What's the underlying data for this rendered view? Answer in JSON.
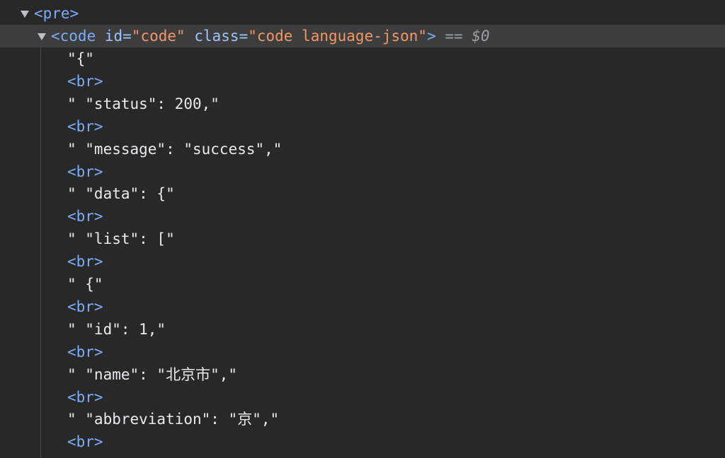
{
  "tree": {
    "pre_tag": "<pre>",
    "code_line": {
      "open": "<code",
      "id_attr": "id",
      "id_value": "\"code\"",
      "class_attr": "class",
      "class_value": "\"code language-json\"",
      "close": ">",
      "selected_marker": "==",
      "selected_var": "$0"
    },
    "children": [
      {
        "kind": "text",
        "value": "\"{\""
      },
      {
        "kind": "br",
        "value": "<br>"
      },
      {
        "kind": "text",
        "value": "\" \"status\": 200,\""
      },
      {
        "kind": "br",
        "value": "<br>"
      },
      {
        "kind": "text",
        "value": "\" \"message\": \"success\",\""
      },
      {
        "kind": "br",
        "value": "<br>"
      },
      {
        "kind": "text",
        "value": "\" \"data\": {\""
      },
      {
        "kind": "br",
        "value": "<br>"
      },
      {
        "kind": "text",
        "value": "\" \"list\": [\""
      },
      {
        "kind": "br",
        "value": "<br>"
      },
      {
        "kind": "text",
        "value": "\" {\""
      },
      {
        "kind": "br",
        "value": "<br>"
      },
      {
        "kind": "text",
        "value": "\" \"id\": 1,\""
      },
      {
        "kind": "br",
        "value": "<br>"
      },
      {
        "kind": "text",
        "value": "\" \"name\": \"北京市\",\""
      },
      {
        "kind": "br",
        "value": "<br>"
      },
      {
        "kind": "text",
        "value": "\" \"abbreviation\": \"京\",\""
      },
      {
        "kind": "br",
        "value": "<br>"
      }
    ]
  },
  "colors": {
    "background": "#282828",
    "selected_row": "#3d3d3d",
    "tag": "#7cacf8",
    "attr_name": "#9fc4ff",
    "attr_value": "#f29766",
    "text": "#e8eaed",
    "muted": "#9aa0a6"
  },
  "icons": {
    "expand": "triangle-down-icon"
  }
}
